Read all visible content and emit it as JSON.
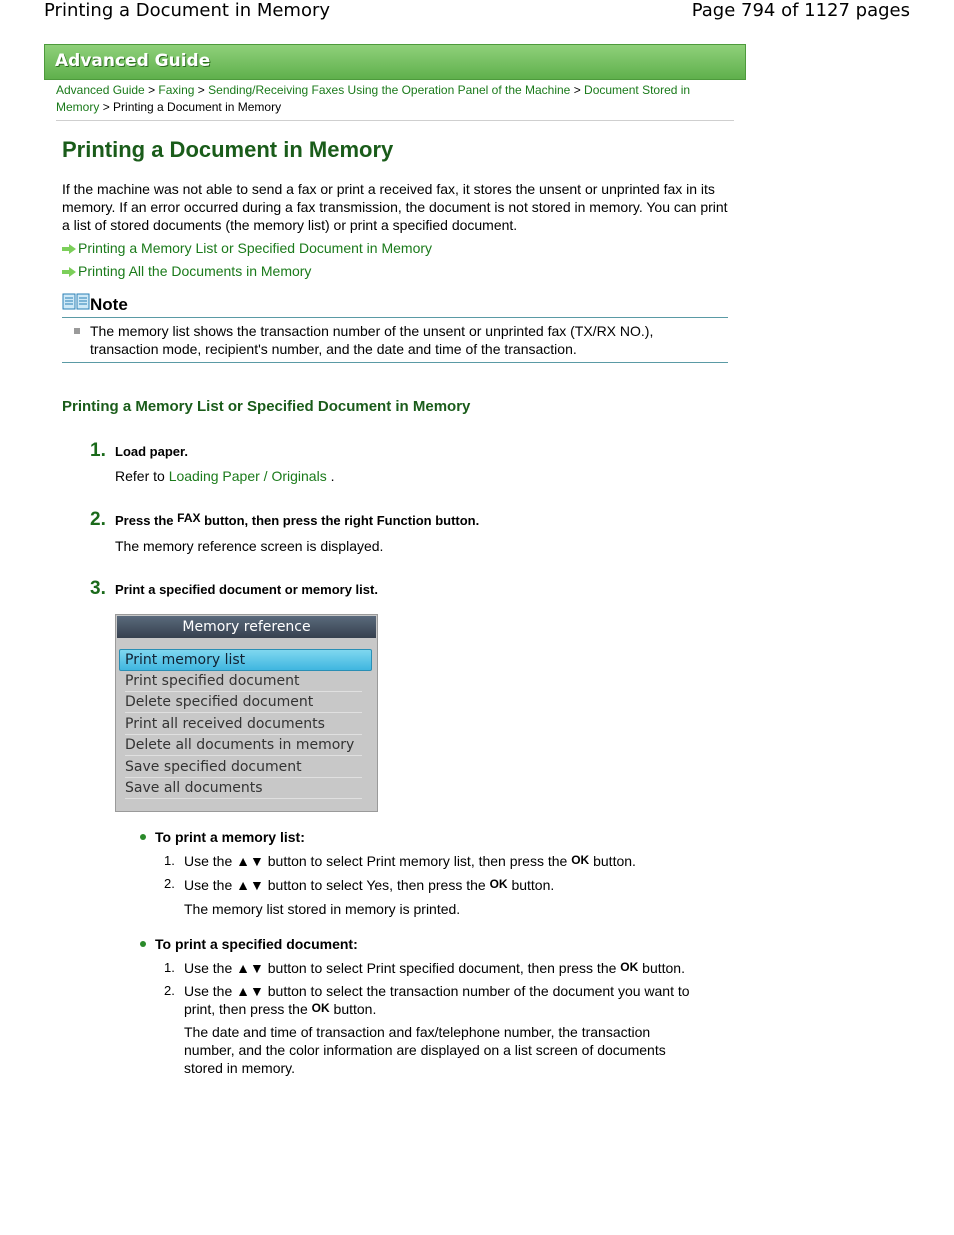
{
  "header": {
    "doc_title": "Printing a Document in Memory",
    "page_info": "Page 794 of 1127 pages"
  },
  "banner": {
    "label": "Advanced Guide"
  },
  "breadcrumb": {
    "links": [
      "Advanced Guide",
      "Faxing",
      "Sending/Receiving Faxes Using the Operation Panel of the Machine",
      "Document Stored in Memory"
    ],
    "separator": ">",
    "current": "Printing a Document in Memory"
  },
  "title": "Printing a Document in Memory",
  "intro": "If the machine was not able to send a fax or print a received fax, it stores the unsent or unprinted fax in its memory. If an error occurred during a fax transmission, the document is not stored in memory. You can print a list of stored documents (the memory list) or print a specified document.",
  "links": [
    "Printing a Memory List or Specified Document in Memory",
    "Printing All the Documents in Memory"
  ],
  "note": {
    "heading": "Note",
    "text": "The memory list shows the transaction number of the unsent or unprinted fax (TX/RX NO.), transaction mode, recipient's number, and the date and time of the transaction."
  },
  "section_title": "Printing a Memory List or Specified Document in Memory",
  "steps": [
    {
      "num": "1.",
      "title": "Load paper.",
      "body_pre": "Refer to ",
      "body_link": "Loading Paper / Originals",
      "body_post": " ."
    },
    {
      "num": "2.",
      "title_pre": "Press the ",
      "title_key": "FAX",
      "title_post": " button, then press the right Function button.",
      "body": "The memory reference screen is displayed."
    },
    {
      "num": "3.",
      "title": "Print a specified document or memory list."
    }
  ],
  "lcd": {
    "title": "Memory reference",
    "items": [
      "Print memory list",
      "Print specified document",
      "Delete specified document",
      "Print all received documents",
      "Delete all documents in memory",
      "Save specified document",
      "Save all documents"
    ],
    "selected_index": 0
  },
  "memory_list": {
    "heading": "To print a memory list:",
    "items": [
      {
        "num": "1.",
        "pre": "Use the ▲▼ button to select Print memory list, then press the ",
        "key": "OK",
        "post": " button."
      },
      {
        "num": "2.",
        "pre": "Use the ▲▼ button to select Yes, then press the ",
        "key": "OK",
        "post": " button."
      }
    ],
    "result": "The memory list stored in memory is printed."
  },
  "specified": {
    "heading": "To print a specified document:",
    "items": [
      {
        "num": "1.",
        "pre": "Use the ▲▼ button to select Print specified document, then press the ",
        "key": "OK",
        "post": " button."
      },
      {
        "num": "2.",
        "pre": "Use the ▲▼ button to select the transaction number of the document you want to print, then press the ",
        "key": "OK",
        "post": " button."
      }
    ],
    "result": "The date and time of transaction and fax/telephone number, the transaction number, and the color information are displayed on a list screen of documents stored in memory."
  }
}
